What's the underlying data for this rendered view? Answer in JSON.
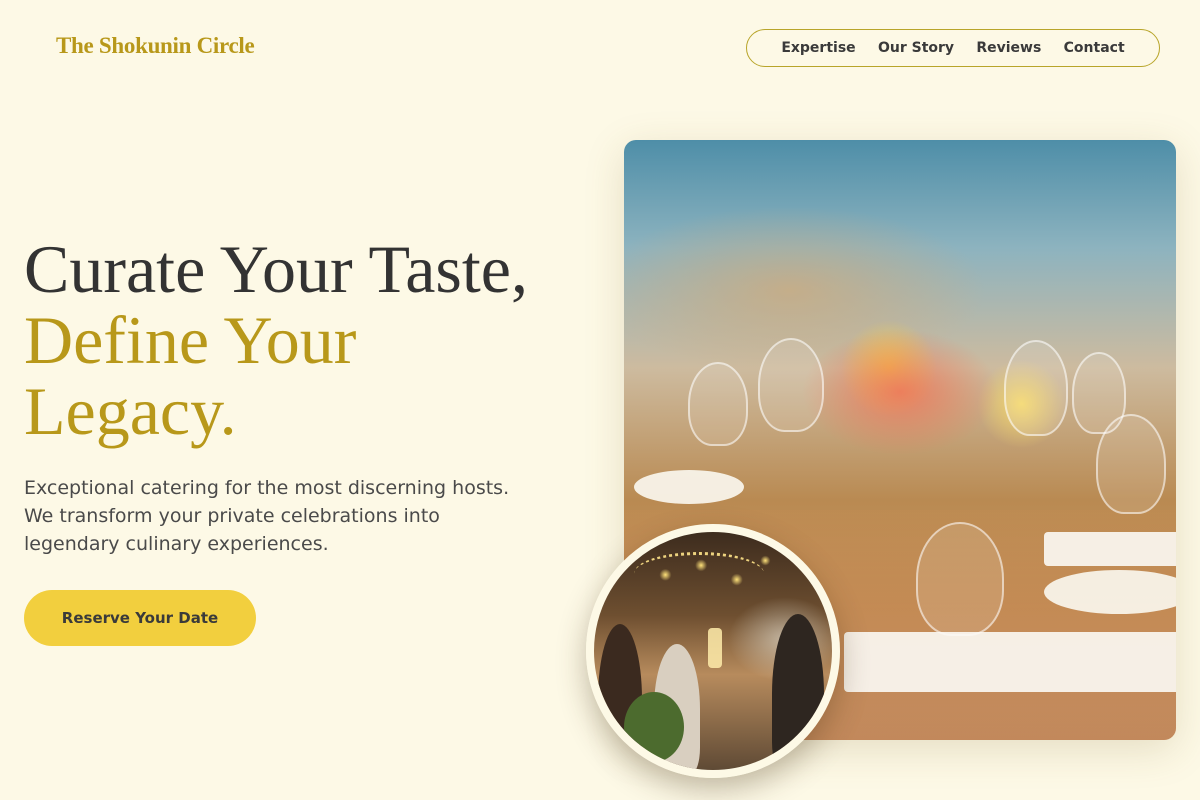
{
  "brand": {
    "name": "The Shokunin Circle"
  },
  "nav": {
    "items": [
      {
        "label": "Expertise"
      },
      {
        "label": "Our Story"
      },
      {
        "label": "Reviews"
      },
      {
        "label": "Contact"
      }
    ]
  },
  "hero": {
    "title_line1": "Curate Your Taste,",
    "title_accent_line1": "Define Your",
    "title_accent_line2": "Legacy.",
    "description_line1": "Exceptional catering for the most discerning hosts.",
    "description_line2": "We transform your private celebrations into",
    "description_line3": "legendary culinary experiences.",
    "cta_label": "Reserve Your Date"
  },
  "colors": {
    "background": "#fdf9e6",
    "brand_gold": "#b8981a",
    "cta_yellow": "#f2cf3e",
    "text_dark": "#333333"
  },
  "images": {
    "main": "banquet-table-flowers-photo",
    "inset": "guests-toasting-photo"
  }
}
